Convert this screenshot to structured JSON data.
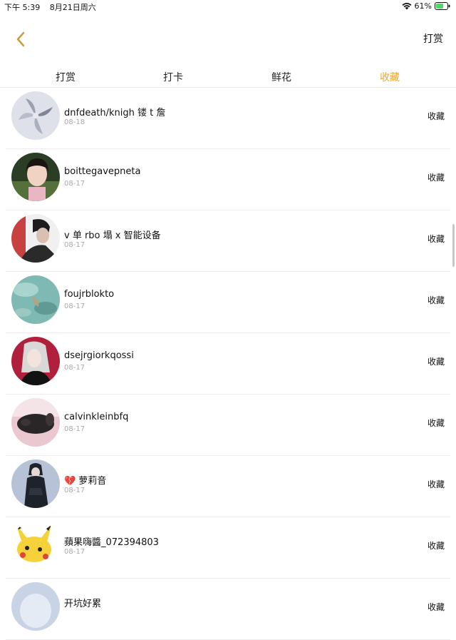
{
  "status_bar": {
    "time": "下午 5:39",
    "date": "8月21日周六",
    "battery": "61%"
  },
  "nav": {
    "back_icon": "chevron-left-icon",
    "right_label": "打赏"
  },
  "tabs": [
    {
      "label": "打赏",
      "active": false
    },
    {
      "label": "打卡",
      "active": false
    },
    {
      "label": "鲜花",
      "active": false
    },
    {
      "label": "收藏",
      "active": true
    }
  ],
  "colors": {
    "accent": "#e6a63a",
    "date_gray": "#aaaaaa",
    "divider": "#ededed"
  },
  "items": [
    {
      "name": "dnfdeath/knigh 镂 t 詹",
      "date": "08-18",
      "action": "收藏",
      "avatar_tone": "#dfe1ea"
    },
    {
      "name": "boittegavepneta",
      "date": "08-17",
      "action": "收藏",
      "avatar_tone": "#2b3d24"
    },
    {
      "name": "v 单 rbo 塌 x 智能设备",
      "date": "08-17",
      "action": "收藏",
      "avatar_tone": "#4a4a4a"
    },
    {
      "name": "foujrblokto",
      "date": "08-17",
      "action": "收藏",
      "avatar_tone": "#7fb9b3"
    },
    {
      "name": "dsejrgiorkqossi",
      "date": "08-17",
      "action": "收藏",
      "avatar_tone": "#b01f3c"
    },
    {
      "name": "calvinkleinbfq",
      "date": "08-17",
      "action": "收藏",
      "avatar_tone": "#e9c8cf"
    },
    {
      "name": "萝莉音",
      "date": "08-17",
      "action": "收藏",
      "avatar_tone": "#1e2229",
      "heart": "💔"
    },
    {
      "name": "蘋果嗨醬_072394803",
      "date": "08-17",
      "action": "收藏",
      "avatar_tone": "#f5d23a"
    },
    {
      "name": "开坑好累",
      "date": "",
      "action": "收藏",
      "avatar_tone": "#c9d3e6"
    }
  ]
}
